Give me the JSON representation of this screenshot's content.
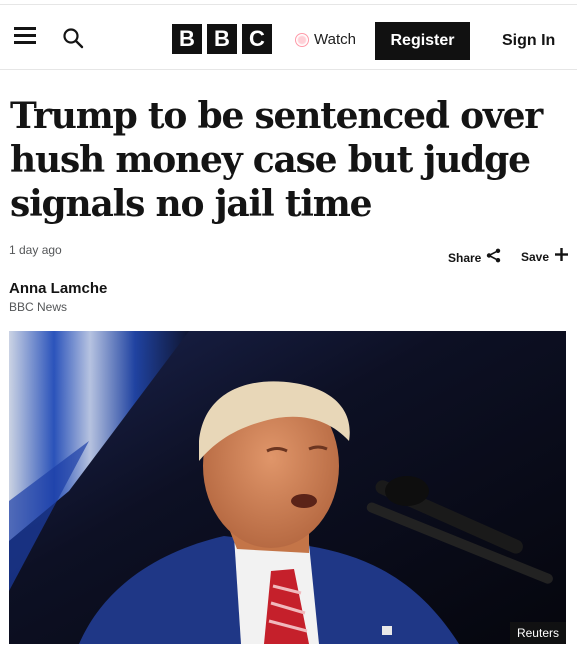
{
  "header": {
    "brand_letters": [
      "B",
      "B",
      "C"
    ],
    "watch_label": "Watch",
    "register_label": "Register",
    "signin_label": "Sign In",
    "accent_color": "#ff9aa8"
  },
  "article": {
    "headline": "Trump to be sentenced over hush money case but judge signals no jail time",
    "timestamp": "1 day ago",
    "share_label": "Share",
    "save_label": "Save",
    "author": "Anna Lamche",
    "outlet": "BBC News",
    "image_credit": "Reuters"
  },
  "icons": {
    "menu": "hamburger-menu-icon",
    "search": "search-icon",
    "share": "share-icon",
    "save": "plus-icon"
  }
}
